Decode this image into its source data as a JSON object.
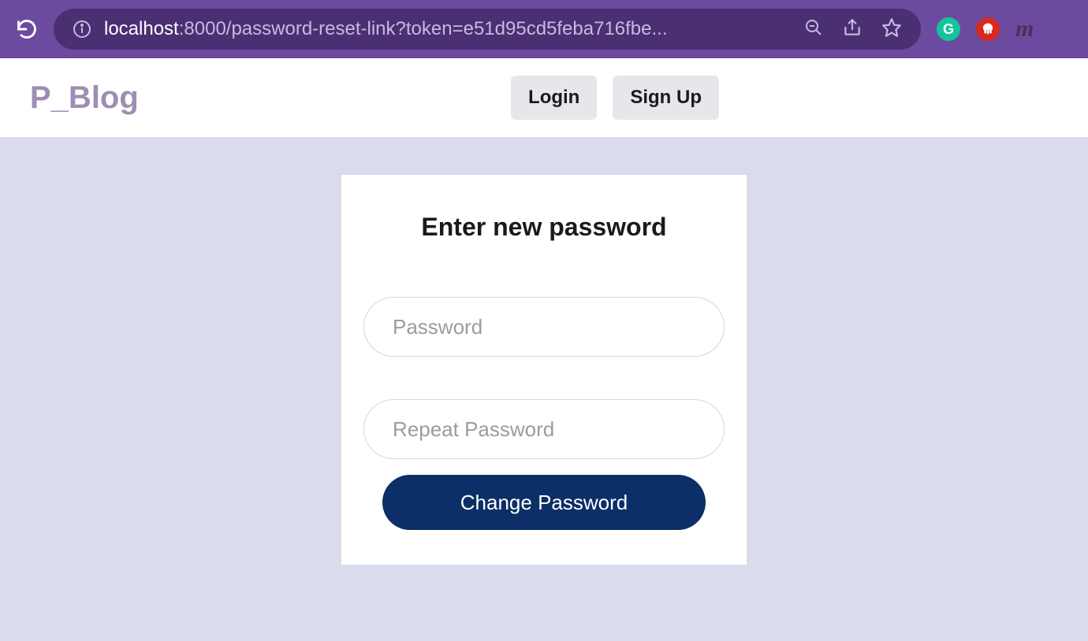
{
  "browser": {
    "url_host": "localhost",
    "url_path": ":8000/password-reset-link?token=e51d95cd5feba716fbe..."
  },
  "header": {
    "logo": "P_Blog",
    "login_label": "Login",
    "signup_label": "Sign Up"
  },
  "form": {
    "title": "Enter new password",
    "password_placeholder": "Password",
    "repeat_placeholder": "Repeat Password",
    "submit_label": "Change Password"
  },
  "extensions": {
    "g": "G",
    "hand": "✋",
    "m": "m"
  }
}
